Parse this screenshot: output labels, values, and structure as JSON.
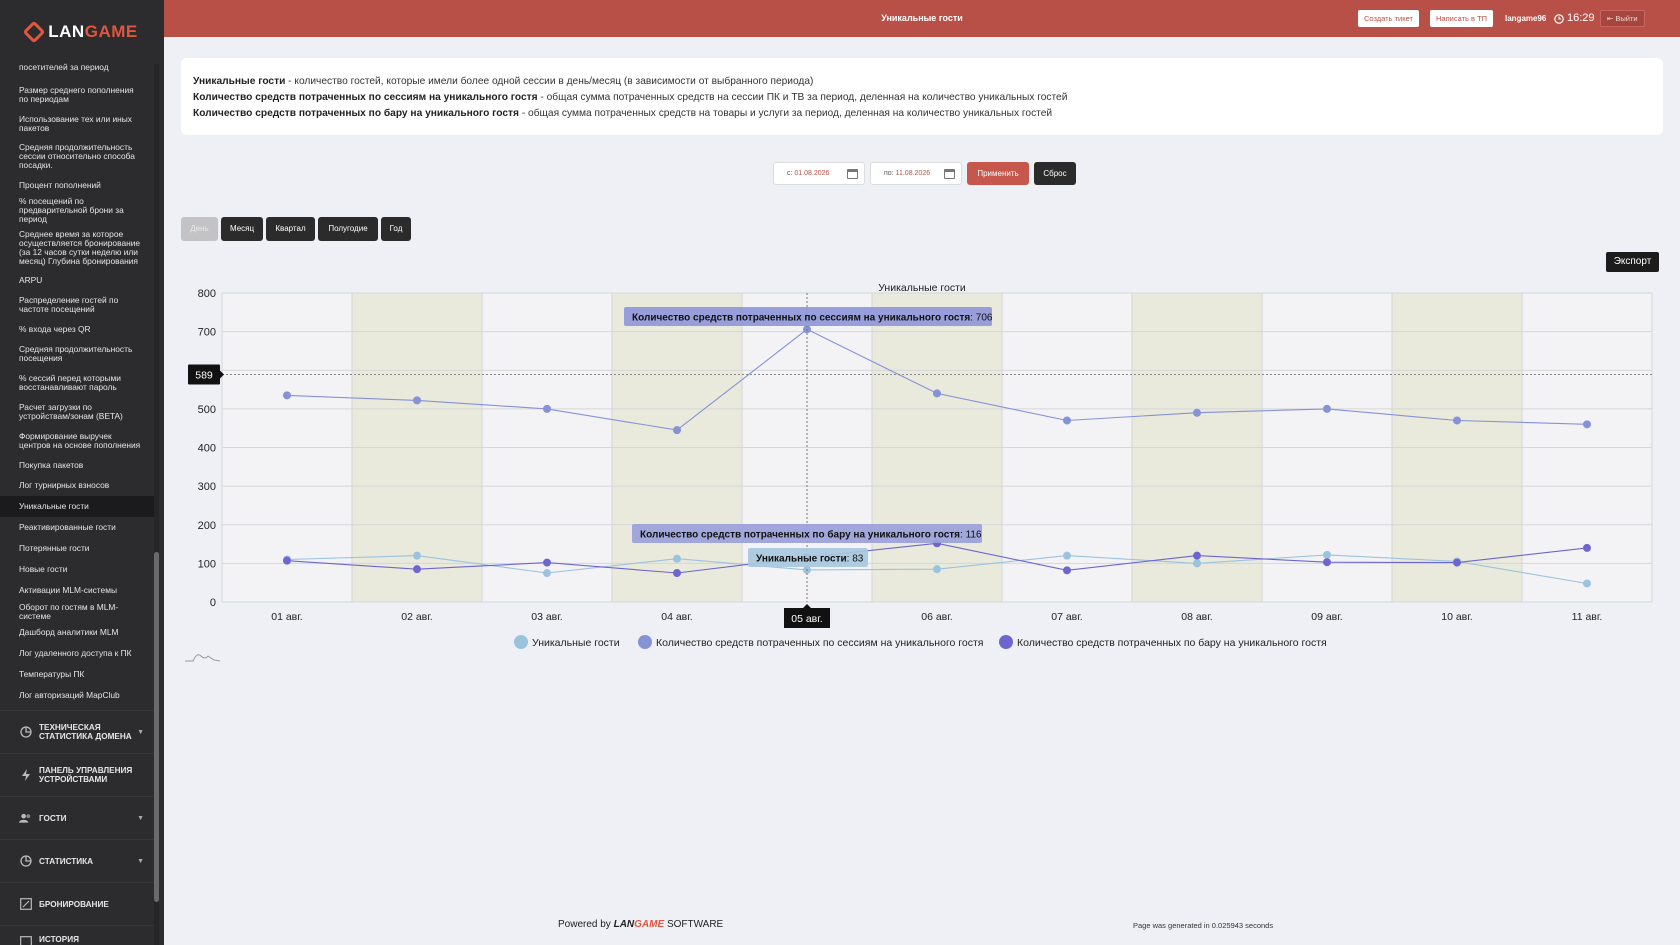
{
  "app": {
    "logo_pre": "LAN",
    "logo_post": "GAME",
    "page_title": "Уникальные гости"
  },
  "header": {
    "create_ticket": "Создать тикет",
    "write_support": "Написать в ТП",
    "username": "langame96",
    "time": "16:29",
    "logout": "Выйти"
  },
  "sidebar": {
    "items": [
      {
        "label": "посетителей за период"
      },
      {
        "label": "Размер среднего пополнения по периодам"
      },
      {
        "label": "Использование тех или иных пакетов"
      },
      {
        "label": "Средняя продолжительность сессии относительно способа посадки."
      },
      {
        "label": "Процент пополнений"
      },
      {
        "label": "% посещений по предварительной брони за период"
      },
      {
        "label": "Среднее время за которое осуществляется бронирование (за 12 часов сутки неделю или месяц) Глубина бронирования"
      },
      {
        "label": "ARPU"
      },
      {
        "label": "Распределение гостей по частоте посещений"
      },
      {
        "label": "% входа через QR"
      },
      {
        "label": "Средняя продолжительность посещения"
      },
      {
        "label": "% сессий перед которыми восстанавливают пароль"
      },
      {
        "label": "Расчет загрузки по устройствам/зонам (BETA)"
      },
      {
        "label": "Формирование выручек центров на основе пополнения"
      },
      {
        "label": "Покупка пакетов"
      },
      {
        "label": "Лог турнирных взносов"
      },
      {
        "label": "Уникальные гости"
      },
      {
        "label": "Реактивированные гости"
      },
      {
        "label": "Потерянные гости"
      },
      {
        "label": "Новые гости"
      },
      {
        "label": "Активации MLM-системы"
      },
      {
        "label": "Оборот по гостям в MLM-системе"
      },
      {
        "label": "Дашборд аналитики MLM"
      },
      {
        "label": "Лог удаленного доступа к ПК"
      },
      {
        "label": "Температуры ПК"
      },
      {
        "label": "Лог авторизаций MapClub"
      }
    ],
    "sections": [
      {
        "label": "ТЕХНИЧЕСКАЯ СТАТИСТИКА ДОМЕНА"
      },
      {
        "label": "ПАНЕЛЬ УПРАВЛЕНИЯ УСТРОЙСТВАМИ"
      },
      {
        "label": "ГОСТИ"
      },
      {
        "label": "СТАТИСТИКА"
      },
      {
        "label": "БРОНИРОВАНИЕ"
      },
      {
        "label": "ИСТОРИЯ"
      }
    ]
  },
  "info": {
    "line1_term": "Уникальные гости",
    "line1_desc": " - количество гостей, которые имели более одной сессии в день/месяц (в зависимости от выбранного периода)",
    "line2_term": "Количество средств потраченных по сессиям на уникального гостя",
    "line2_desc": " - общая сумма потраченных средств на сессии ПК и ТВ за период, деленная на количество уникальных гостей",
    "line3_term": "Количество средств потраченных по бару на уникального гостя",
    "line3_desc": " - общая сумма потраченных средств на товары и услуги за период, деленная на количество уникальных гостей"
  },
  "filter": {
    "from_label": "с:",
    "from_value": "01.08.2026",
    "to_label": "по:",
    "to_value": "11.08.2026",
    "apply": "Применить",
    "reset": "Сброс"
  },
  "periods": [
    "День",
    "Месяц",
    "Квартал",
    "Полугодие",
    "Год"
  ],
  "export_label": "Экспорт",
  "chart_data": {
    "type": "line",
    "title": "Уникальные гости",
    "categories": [
      "01 авг.",
      "02 авг.",
      "03 авг.",
      "04 авг.",
      "05 авг.",
      "06 авг.",
      "07 авг.",
      "08 авг.",
      "09 авг.",
      "10 авг.",
      "11 авг."
    ],
    "ylim": [
      0,
      800
    ],
    "yticks": [
      0,
      100,
      200,
      300,
      400,
      500,
      600,
      700,
      800
    ],
    "grid": true,
    "legend": "bottom",
    "series": [
      {
        "name": "Уникальные гости",
        "color": "#9bc3de",
        "values": [
          110,
          120,
          75,
          112,
          83,
          85,
          120,
          100,
          122,
          105,
          48
        ]
      },
      {
        "name": "Количество средств потраченных по сессиям на уникального гостя",
        "color": "#8592d6",
        "values": [
          535,
          522,
          500,
          445,
          706,
          540,
          470,
          490,
          500,
          470,
          460
        ]
      },
      {
        "name": "Количество средств потраченных по бару на уникального гостя",
        "color": "#6e66cf",
        "values": [
          107,
          85,
          102,
          75,
          116,
          152,
          82,
          120,
          103,
          102,
          140
        ]
      }
    ],
    "hover": {
      "category_index": 4,
      "crosshair_value": "589",
      "category_label": "05 авг.",
      "tooltips": [
        {
          "series": "Количество средств потраченных по сессиям на уникального гостя",
          "value": "706"
        },
        {
          "series": "Количество средств потраченных по бару на уникального гостя",
          "value": "116"
        },
        {
          "series": "Уникальные гости",
          "value": "83"
        }
      ]
    }
  },
  "footer": {
    "powered_by": "Powered by",
    "brand_pre": "LAN",
    "brand_post": "GAME",
    "software": "SOFTWARE",
    "generated": "Page was generated in 0.025943 seconds"
  }
}
